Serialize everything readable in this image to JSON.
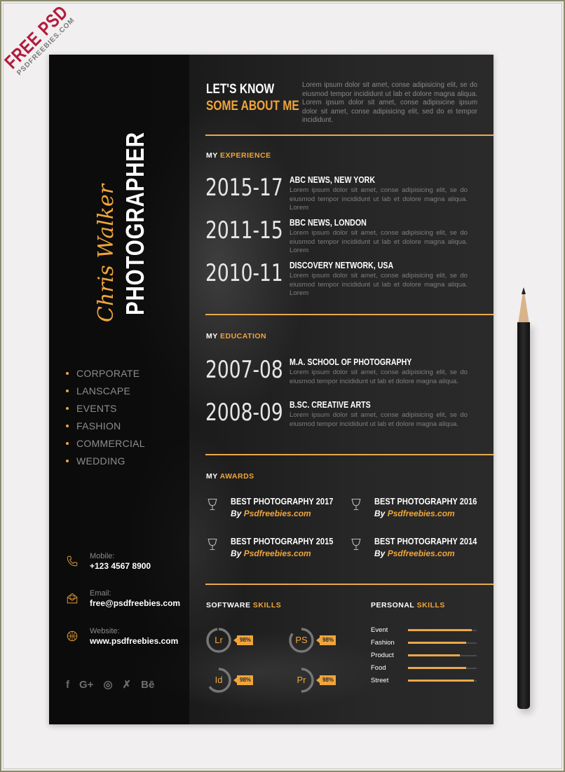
{
  "watermark": {
    "title": "FREE PSD",
    "subtitle": "PSDFREEBIES.COM",
    "color": "#b31b3d"
  },
  "colors": {
    "accent": "#f0a53a",
    "page_bg": "#1d1d1d",
    "backdrop": "#f1eff0"
  },
  "profile": {
    "name": "Chris Walker",
    "role": "PHOTOGRAPHER"
  },
  "services": [
    "CORPORATE",
    "LANSCAPE",
    "EVENTS",
    "FASHION",
    "COMMERCIAL",
    "WEDDING"
  ],
  "contact": [
    {
      "icon": "phone-icon",
      "label": "Mobile:",
      "value": "+123 4567 8900"
    },
    {
      "icon": "envelope-icon",
      "label": "Email:",
      "value": "free@psdfreebies.com"
    },
    {
      "icon": "globe-icon",
      "label": "Website:",
      "value": "www.psdfreebies.com"
    }
  ],
  "socials": [
    {
      "icon": "facebook-icon",
      "glyph": "f"
    },
    {
      "icon": "google-plus-icon",
      "glyph": "G+"
    },
    {
      "icon": "dribbble-icon",
      "glyph": "◎"
    },
    {
      "icon": "xing-icon",
      "glyph": "✗"
    },
    {
      "icon": "behance-icon",
      "glyph": "Bē"
    }
  ],
  "about": {
    "heading_line1": "LET'S KNOW",
    "heading_line2": "SOME ABOUT ME",
    "text": "Lorem ipsum dolor sit amet, conse adipisicing elit, se do eiusmod tempor incididunt ut lab et dolore magna aliqua. Lorem ipsum dolor sit amet, conse adipisicine ipsum dolor sit amet, conse adipisicing elit, sed do ei tempor incididunt."
  },
  "experience": {
    "heading_prefix": "MY",
    "heading_accent": "EXPERIENCE",
    "items": [
      {
        "years": "2015-17",
        "title": "ABC NEWS, NEW YORK",
        "desc": "Lorem ipsum dolor sit amet, conse adipisicing elit, se do eiusmod tempor incididunt ut lab et dolore magna aliqua. Lorem"
      },
      {
        "years": "2011-15",
        "title": "BBC NEWS, LONDON",
        "desc": "Lorem ipsum dolor sit amet, conse adipisicing elit, se do eiusmod tempor incididunt ut lab et dolore magna aliqua. Lorem"
      },
      {
        "years": "2010-11",
        "title": "DISCOVERY NETWORK, USA",
        "desc": "Lorem ipsum dolor sit amet, conse adipisicing elit, se do eiusmod tempor incididunt ut lab et dolore magna aliqua. Lorem"
      }
    ]
  },
  "education": {
    "heading_prefix": "MY",
    "heading_accent": "EDUCATION",
    "items": [
      {
        "years": "2007-08",
        "title": "M.A. SCHOOL OF PHOTOGRAPHY",
        "desc": "Lorem ipsum dolor sit amet, conse adipisicing elit, se do eiusmod tempor incididunt ut lab et dolore magna aliqua."
      },
      {
        "years": "2008-09",
        "title": "B.SC. CREATIVE ARTS",
        "desc": "Lorem ipsum dolor sit amet, conse adipisicing elit, se do eiusmod tempor incididunt ut lab et dolore magna aliqua."
      }
    ]
  },
  "awards": {
    "heading_prefix": "MY",
    "heading_accent": "AWARDS",
    "items": [
      {
        "title": "BEST PHOTOGRAPHY 2017",
        "by": "By",
        "source": "Psdfreebies.com"
      },
      {
        "title": "BEST PHOTOGRAPHY 2016",
        "by": "By",
        "source": "Psdfreebies.com"
      },
      {
        "title": "BEST PHOTOGRAPHY 2015",
        "by": "By",
        "source": "Psdfreebies.com"
      },
      {
        "title": "BEST PHOTOGRAPHY 2014",
        "by": "By",
        "source": "Psdfreebies.com"
      }
    ]
  },
  "software_skills": {
    "heading_prefix": "SOFTWARE",
    "heading_accent": "SKILLS",
    "items": [
      {
        "abbr": "Lr",
        "percent_label": "98%",
        "ring_fraction": 0.98
      },
      {
        "abbr": "PS",
        "percent_label": "98%",
        "ring_fraction": 0.85
      },
      {
        "abbr": "Id",
        "percent_label": "98%",
        "ring_fraction": 0.65
      },
      {
        "abbr": "Pr",
        "percent_label": "98%",
        "ring_fraction": 0.5
      }
    ]
  },
  "personal_skills": {
    "heading_prefix": "PERSONAL",
    "heading_accent": "SKILLS",
    "items": [
      {
        "label": "Event",
        "level": 0.93
      },
      {
        "label": "Fashion",
        "level": 0.85
      },
      {
        "label": "Product",
        "level": 0.76
      },
      {
        "label": "Food",
        "level": 0.85
      },
      {
        "label": "Street",
        "level": 0.96
      }
    ]
  }
}
